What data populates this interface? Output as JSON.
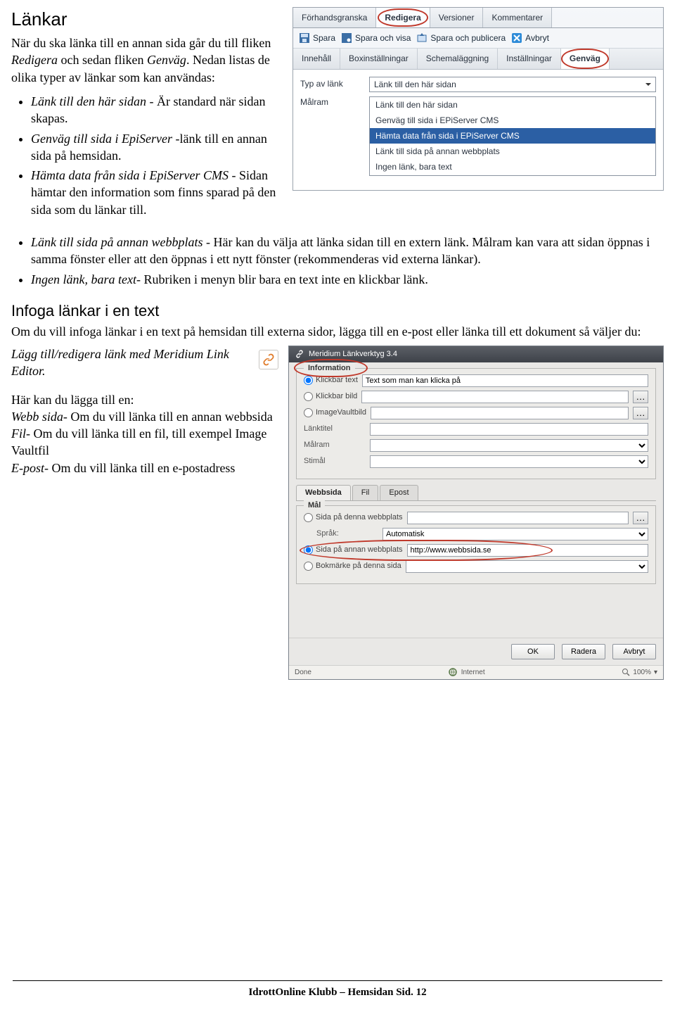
{
  "doc": {
    "title": "Länkar",
    "intro1": "När du ska länka till en annan sida går du till fliken ",
    "intro_em1": "Redigera",
    "intro_mid": " och sedan fliken ",
    "intro_em2": "Genväg",
    "intro2": ". Nedan listas  de olika  typer av länkar som kan användas:",
    "bullets_top": [
      {
        "em": "Länk till den här sidan",
        "rest": " - Är standard när sidan skapas."
      },
      {
        "em": "Genväg till sida i EpiServer",
        "rest": " -länk till en annan sida på hemsidan."
      },
      {
        "em": "Hämta data från sida i EpiServer CMS",
        "rest": " - Sidan hämtar den information som finns sparad på den sida som du länkar till."
      }
    ],
    "bullets_full": [
      {
        "em": "Länk till sida på annan webbplats",
        "rest": " - Här kan du välja att länka sidan till en extern länk. Målram kan vara att sidan öppnas i samma fönster eller att den öppnas i ett nytt fönster (rekommenderas vid externa länkar)."
      },
      {
        "em": "Ingen länk, bara text",
        "rest": "- Rubriken i menyn blir bara en text inte en klickbar länk."
      }
    ],
    "h2": "Infoga länkar i en text",
    "p2": "Om du vill infoga länkar i en text på hemsidan till externa sidor, lägga till en e-post eller länka till ett dokument så väljer du:",
    "p3_em": "Lägg till/redigera länk med Meridium Link Editor.",
    "p4_plain": "Här kan du lägga till en:",
    "def": [
      {
        "em": "Webb sida",
        "rest": "- Om du vill länka till en annan  webbsida"
      },
      {
        "em": "Fil",
        "rest": "- Om du vill länka till en fil, till exempel Image Vaultfil"
      },
      {
        "em": "E-post",
        "rest": "- Om du vill länka till en e-postadress"
      }
    ],
    "footer": "IdrottOnline Klubb – Hemsidan Sid. 12"
  },
  "epi": {
    "tabs": [
      "Förhandsgranska",
      "Redigera",
      "Versioner",
      "Kommentarer"
    ],
    "active_tab": 1,
    "actions": {
      "save": "Spara",
      "save_show": "Spara och visa",
      "save_publish": "Spara och publicera",
      "cancel": "Avbryt"
    },
    "subtabs": [
      "Innehåll",
      "Boxinställningar",
      "Schemaläggning",
      "Inställningar",
      "Genväg"
    ],
    "active_subtab": 4,
    "form": {
      "type_label": "Typ av länk",
      "type_value": "Länk till den här sidan",
      "target_label": "Målram"
    },
    "dropdown": {
      "items": [
        "Länk till den här sidan",
        "Genväg till sida i EPiServer CMS",
        "Hämta data från sida i EPiServer CMS",
        "Länk till sida på annan webbplats",
        "Ingen länk, bara text"
      ],
      "selected": 2
    }
  },
  "dlg": {
    "title": "Meridium Länkverktyg 3.4",
    "info_legend": "Information",
    "radio_text": "Klickbar text",
    "radio_text_value": "Text som man kan klicka på",
    "radio_image": "Klickbar bild",
    "radio_iv": "ImageVaultbild",
    "linktitle_label": "Länktitel",
    "target_label": "Målram",
    "stimal_label": "Stimål",
    "tabs": [
      "Webbsida",
      "Fil",
      "Epost"
    ],
    "active_tab": 0,
    "mal_legend": "Mål",
    "r1": "Sida på denna webbplats",
    "lang_label": "Språk:",
    "lang_value": "Automatisk",
    "r2": "Sida på annan webbplats",
    "r2_value": "http://www.webbsida.se",
    "r3": "Bokmärke på denna sida",
    "buttons": {
      "ok": "OK",
      "delete": "Radera",
      "cancel": "Avbryt"
    },
    "status_left": "Done",
    "status_mid": "Internet",
    "status_zoom": "100%"
  }
}
